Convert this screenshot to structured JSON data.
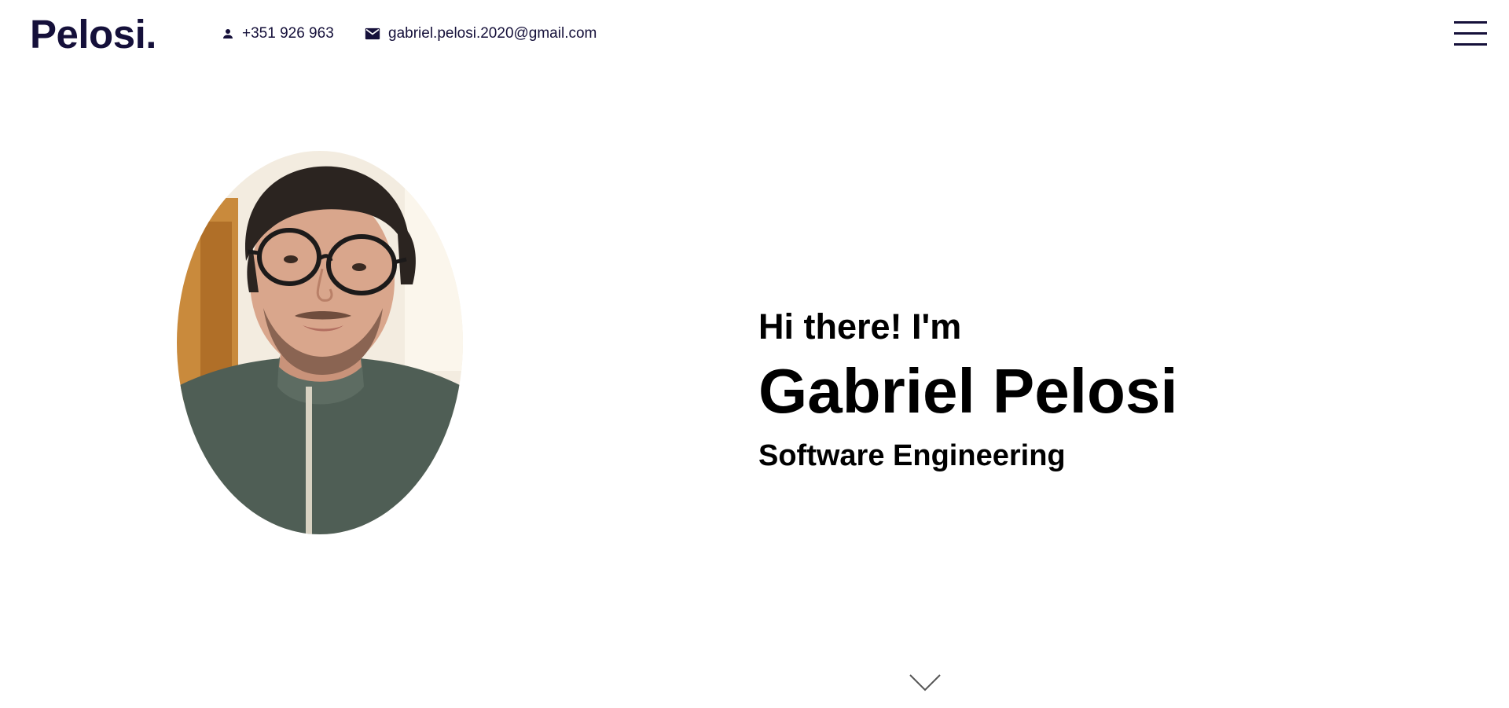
{
  "header": {
    "logo": "Pelosi.",
    "phone": "+351 926 963",
    "email": "gabriel.pelosi.2020@gmail.com",
    "phone_icon": "person-icon",
    "email_icon": "envelope-icon",
    "menu_icon": "hamburger-menu-icon"
  },
  "hero": {
    "greeting": "Hi there! I'm",
    "name": "Gabriel Pelosi",
    "role": "Software Engineering",
    "photo": "profile-photo",
    "scroll_icon": "chevron-down-icon"
  },
  "colors": {
    "brand": "#15103a",
    "text": "#000000",
    "background": "#ffffff"
  }
}
